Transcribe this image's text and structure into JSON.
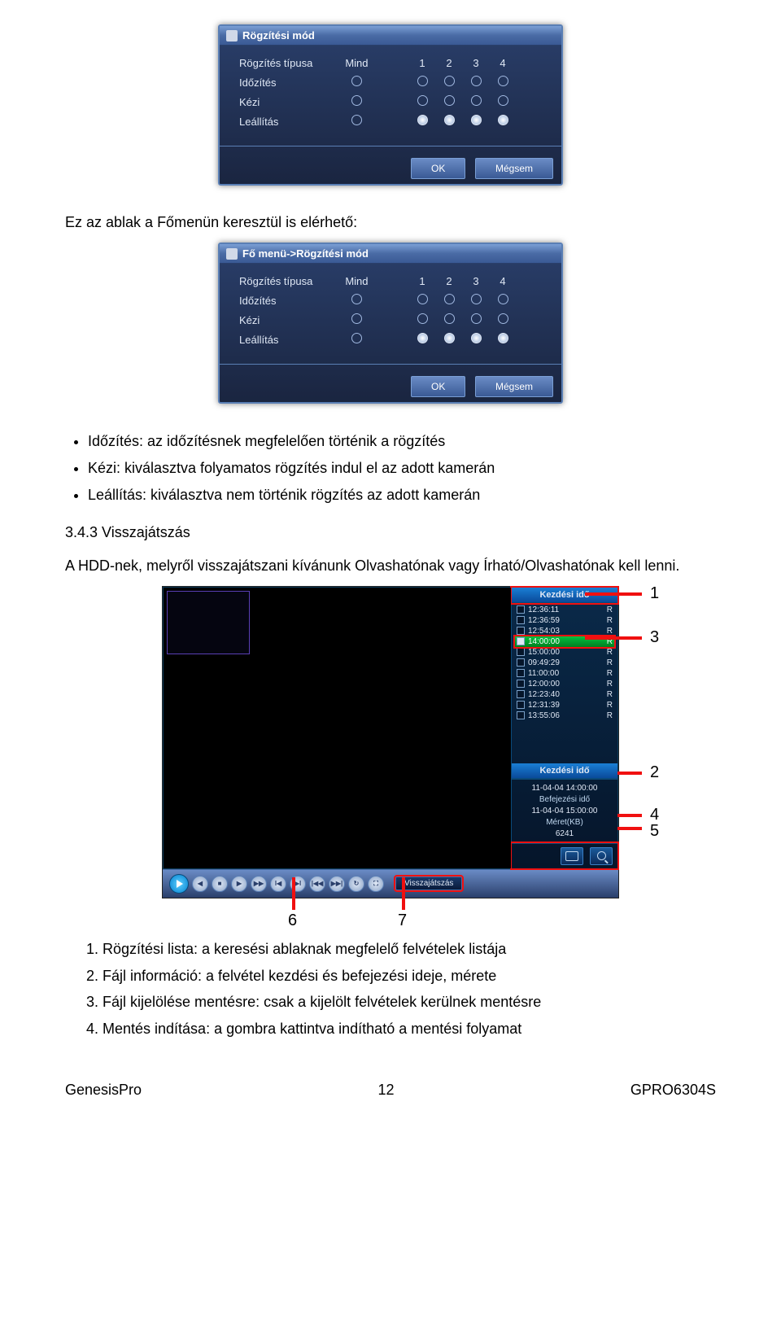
{
  "dlg1": {
    "title": "Rögzítési mód",
    "row_type": "Rögzítés típusa",
    "col_all": "Mind",
    "col1": "1",
    "col2": "2",
    "col3": "3",
    "col4": "4",
    "row_timing": "Időzítés",
    "row_manual": "Kézi",
    "row_stop": "Leállítás",
    "btn_ok": "OK",
    "btn_cancel": "Mégsem"
  },
  "text1": "Ez az ablak a Főmenün keresztül is elérhető:",
  "dlg2": {
    "title": "Fő menü->Rögzítési mód",
    "row_type": "Rögzítés típusa",
    "col_all": "Mind",
    "col1": "1",
    "col2": "2",
    "col3": "3",
    "col4": "4",
    "row_timing": "Időzítés",
    "row_manual": "Kézi",
    "row_stop": "Leállítás",
    "btn_ok": "OK",
    "btn_cancel": "Mégsem"
  },
  "bullets": [
    "Időzítés: az időzítésnek megfelelően történik a rögzítés",
    "Kézi: kiválasztva folyamatos rögzítés indul el az adott kamerán",
    "Leállítás: kiválasztva nem történik rögzítés az adott kamerán"
  ],
  "section_num": "3.4.3 Visszajátszás",
  "section_body": "A HDD-nek, melyről visszajátszani kívánunk Olvashatónak vagy Írható/Olvashatónak kell lenni.",
  "playback": {
    "side_title": "Kezdési idő",
    "items": [
      {
        "time": "12:36:11",
        "tag": "R",
        "sel": false
      },
      {
        "time": "12:36:59",
        "tag": "R",
        "sel": false
      },
      {
        "time": "12:54:03",
        "tag": "R",
        "sel": false
      },
      {
        "time": "14:00:00",
        "tag": "R",
        "sel": true
      },
      {
        "time": "15:00:00",
        "tag": "R",
        "sel": false
      },
      {
        "time": "09:49:29",
        "tag": "R",
        "sel": false
      },
      {
        "time": "11:00:00",
        "tag": "R",
        "sel": false
      },
      {
        "time": "12:00:00",
        "tag": "R",
        "sel": false
      },
      {
        "time": "12:23:40",
        "tag": "R",
        "sel": false
      },
      {
        "time": "12:31:39",
        "tag": "R",
        "sel": false
      },
      {
        "time": "13:55:06",
        "tag": "R",
        "sel": false
      }
    ],
    "info_start_lbl": "Kezdési idő",
    "info_start_val": "11-04-04 14:00:00",
    "info_end_lbl": "Befejezési idő",
    "info_end_val": "11-04-04 15:00:00",
    "info_size_lbl": "Méret(KB)",
    "info_size_val": "6241",
    "bar_label": "Visszajátszás",
    "ann": {
      "n1": "1",
      "n2": "2",
      "n3": "3",
      "n4": "4",
      "n5": "5",
      "n6": "6",
      "n7": "7"
    }
  },
  "numlist": [
    "Rögzítési lista: a keresési ablaknak megfelelő felvételek listája",
    "Fájl információ: a felvétel kezdési és befejezési ideje, mérete",
    "Fájl kijelölése mentésre: csak a kijelölt felvételek kerülnek mentésre",
    "Mentés indítása: a gombra kattintva indítható a mentési folyamat"
  ],
  "footer": {
    "left": "GenesisPro",
    "mid": "12",
    "right": "GPRO6304S"
  }
}
